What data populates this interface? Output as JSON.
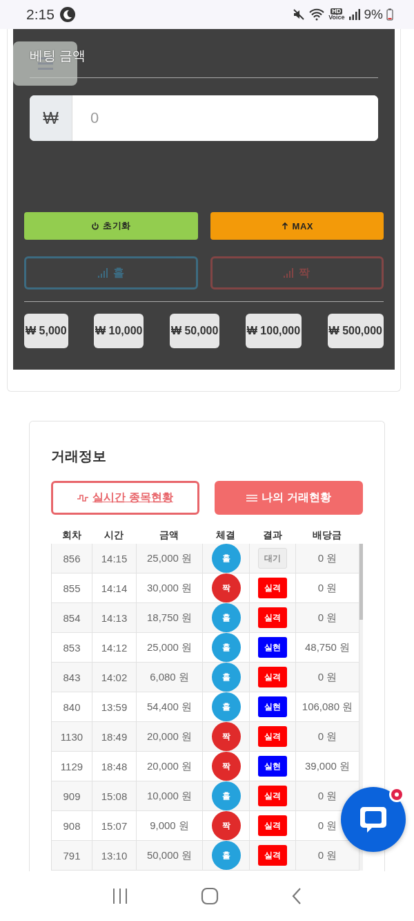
{
  "status_bar": {
    "time": "2:15",
    "hd_label": "HD",
    "voice_label": "Voice",
    "battery": "9%"
  },
  "bet_panel": {
    "title": "베팅 금액",
    "currency_symbol": "₩",
    "amount_placeholder": "0",
    "actions": [
      {
        "label": "초기화",
        "kind": "reset"
      },
      {
        "label": "MAX",
        "kind": "max"
      }
    ],
    "picks": [
      {
        "label": "홀",
        "kind": "odd",
        "disabled": true
      },
      {
        "label": "짝",
        "kind": "even",
        "disabled": true
      }
    ],
    "chips": [
      "₩ 5,000",
      "₩ 10,000",
      "₩ 50,000",
      "₩ 100,000",
      "₩ 500,000"
    ]
  },
  "trade_info": {
    "title": "거래정보",
    "tabs": [
      {
        "label": "실시간 종목현황",
        "kind": "live",
        "selected": false
      },
      {
        "label": "나의 거래현황",
        "kind": "mine",
        "selected": true
      }
    ],
    "table": {
      "columns": [
        "회차",
        "시간",
        "금액",
        "체결",
        "결과",
        "배당금"
      ],
      "rows": [
        {
          "round": "856",
          "time": "14:15",
          "amount": "25,000 원",
          "side": {
            "label": "홀",
            "kind": "odd"
          },
          "result": {
            "label": "대기",
            "kind": "pending"
          },
          "payout": "0 원"
        },
        {
          "round": "855",
          "time": "14:14",
          "amount": "30,000 원",
          "side": {
            "label": "짝",
            "kind": "even"
          },
          "result": {
            "label": "실격",
            "kind": "lose"
          },
          "payout": "0 원"
        },
        {
          "round": "854",
          "time": "14:13",
          "amount": "18,750 원",
          "side": {
            "label": "홀",
            "kind": "odd"
          },
          "result": {
            "label": "실격",
            "kind": "lose"
          },
          "payout": "0 원"
        },
        {
          "round": "853",
          "time": "14:12",
          "amount": "25,000 원",
          "side": {
            "label": "홀",
            "kind": "odd"
          },
          "result": {
            "label": "실현",
            "kind": "win"
          },
          "payout": "48,750 원"
        },
        {
          "round": "843",
          "time": "14:02",
          "amount": "6,080 원",
          "side": {
            "label": "홀",
            "kind": "odd"
          },
          "result": {
            "label": "실격",
            "kind": "lose"
          },
          "payout": "0 원"
        },
        {
          "round": "840",
          "time": "13:59",
          "amount": "54,400 원",
          "side": {
            "label": "홀",
            "kind": "odd"
          },
          "result": {
            "label": "실현",
            "kind": "win"
          },
          "payout": "106,080 원"
        },
        {
          "round": "1130",
          "time": "18:49",
          "amount": "20,000 원",
          "side": {
            "label": "짝",
            "kind": "even"
          },
          "result": {
            "label": "실격",
            "kind": "lose"
          },
          "payout": "0 원"
        },
        {
          "round": "1129",
          "time": "18:48",
          "amount": "20,000 원",
          "side": {
            "label": "짝",
            "kind": "even"
          },
          "result": {
            "label": "실현",
            "kind": "win"
          },
          "payout": "39,000 원"
        },
        {
          "round": "909",
          "time": "15:08",
          "amount": "10,000 원",
          "side": {
            "label": "홀",
            "kind": "odd"
          },
          "result": {
            "label": "실격",
            "kind": "lose"
          },
          "payout": "0 원"
        },
        {
          "round": "908",
          "time": "15:07",
          "amount": "9,000 원",
          "side": {
            "label": "짝",
            "kind": "even"
          },
          "result": {
            "label": "실격",
            "kind": "lose"
          },
          "payout": "0 원"
        },
        {
          "round": "791",
          "time": "13:10",
          "amount": "50,000 원",
          "side": {
            "label": "홀",
            "kind": "odd"
          },
          "result": {
            "label": "실격",
            "kind": "lose"
          },
          "payout": "0 원"
        }
      ]
    }
  },
  "chat": {
    "unread": true
  }
}
